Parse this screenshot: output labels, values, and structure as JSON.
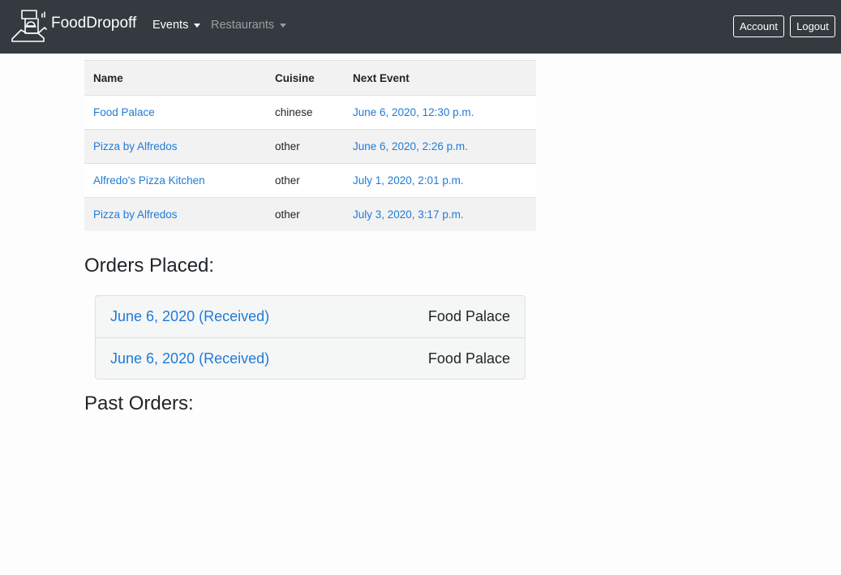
{
  "navbar": {
    "brand": "FoodDropoff",
    "menus": [
      {
        "label": "Events",
        "active": true
      },
      {
        "label": "Restaurants",
        "active": false
      }
    ],
    "account_label": "Account",
    "logout_label": "Logout",
    "background": "#343a40"
  },
  "restaurants_table": {
    "headers": {
      "name": "Name",
      "cuisine": "Cuisine",
      "next_event": "Next Event"
    },
    "rows": [
      {
        "name": "Food Palace",
        "cuisine": "chinese",
        "next_event": "June 6, 2020, 12:30 p.m."
      },
      {
        "name": "Pizza by Alfredos",
        "cuisine": "other",
        "next_event": "June 6, 2020, 2:26 p.m."
      },
      {
        "name": "Alfredo's Pizza Kitchen",
        "cuisine": "other",
        "next_event": "July 1, 2020, 2:01 p.m."
      },
      {
        "name": "Pizza by Alfredos",
        "cuisine": "other",
        "next_event": "July 3, 2020, 3:17 p.m."
      }
    ]
  },
  "orders_placed": {
    "title": "Orders Placed:",
    "items": [
      {
        "date_status": "June 6, 2020 (Received)",
        "restaurant": "Food Palace"
      },
      {
        "date_status": "June 6, 2020 (Received)",
        "restaurant": "Food Palace"
      }
    ]
  },
  "past_orders": {
    "title": "Past Orders:"
  },
  "colors": {
    "link": "#1e7bd8",
    "text": "#212529"
  },
  "icons": {
    "brand_logo": "delivery-tower-icon",
    "dropdown": "caret-down-icon"
  }
}
